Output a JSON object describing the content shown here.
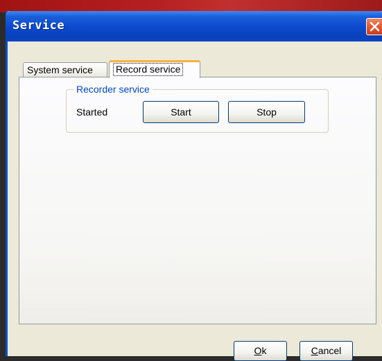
{
  "window": {
    "title": "Service",
    "close_icon": "close-icon"
  },
  "tabs": [
    {
      "label": "System service",
      "selected": false
    },
    {
      "label": "Record service",
      "selected": true
    }
  ],
  "recorder_group": {
    "legend": "Recorder service",
    "status": "Started",
    "start_label": "Start",
    "stop_label": "Stop"
  },
  "dialog_buttons": {
    "ok_mnemonic": "O",
    "ok_rest": "k",
    "cancel_mnemonic": "C",
    "cancel_rest": "ancel"
  },
  "colors": {
    "titlebar": "#0b49cc",
    "close": "#e25a31",
    "legend": "#0046d5",
    "tab_highlight": "#f7b33d"
  }
}
